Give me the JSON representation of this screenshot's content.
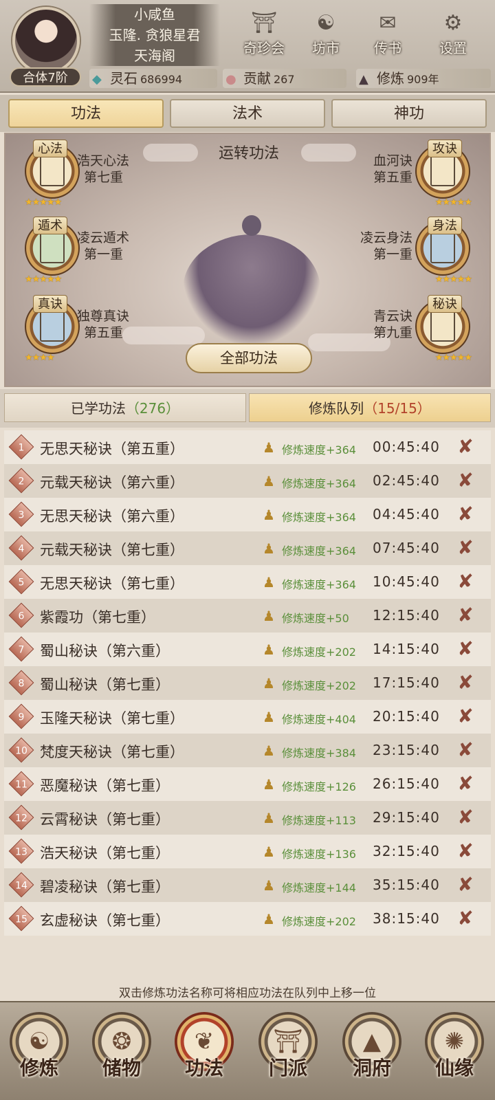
{
  "player": {
    "name": "小咸鱼",
    "title": "玉隆. 贪狼星君",
    "sect": "天海阁",
    "realm": "合体7阶"
  },
  "top_buttons": [
    {
      "label": "奇珍会",
      "icon": "treasure-pavilion-icon"
    },
    {
      "label": "坊市",
      "icon": "market-icon"
    },
    {
      "label": "传书",
      "icon": "scroll-letter-icon"
    },
    {
      "label": "设置",
      "icon": "gear-icon"
    }
  ],
  "resources": [
    {
      "label": "灵石",
      "value": "686994",
      "icon": "spirit-stone-icon"
    },
    {
      "label": "贡献",
      "value": "267",
      "icon": "contribution-icon"
    },
    {
      "label": "修炼",
      "value": "909年",
      "icon": "cultivator-icon"
    }
  ],
  "main_tabs": [
    {
      "label": "功法",
      "active": true
    },
    {
      "label": "法术",
      "active": false
    },
    {
      "label": "神功",
      "active": false
    }
  ],
  "scene": {
    "title": "运转功法",
    "all_button": "全部功法",
    "skills": [
      {
        "type": "心法",
        "name": "浩天心法",
        "level": "第七重",
        "stars": "★★★★★",
        "side": "left"
      },
      {
        "type": "攻诀",
        "name": "血河诀",
        "level": "第五重",
        "stars": "★★★★★",
        "side": "right"
      },
      {
        "type": "遁术",
        "name": "凌云遁术",
        "level": "第一重",
        "stars": "★★★★★",
        "side": "left"
      },
      {
        "type": "身法",
        "name": "凌云身法",
        "level": "第一重",
        "stars": "★★★★★",
        "side": "right"
      },
      {
        "type": "真诀",
        "name": "独尊真诀",
        "level": "第五重",
        "stars": "★★★★",
        "side": "left"
      },
      {
        "type": "秘诀",
        "name": "青云诀",
        "level": "第九重",
        "stars": "★★★★★",
        "side": "right"
      }
    ]
  },
  "sub_tabs": [
    {
      "label": "已学功法",
      "count": "（276）",
      "active": false
    },
    {
      "label": "修炼队列",
      "count": "（15/15）",
      "active": true
    }
  ],
  "queue": [
    {
      "num": "1",
      "name": "无思天秘诀（第五重）",
      "speed": "修炼速度+364",
      "time": "00:45:40"
    },
    {
      "num": "2",
      "name": "元载天秘诀（第六重）",
      "speed": "修炼速度+364",
      "time": "02:45:40"
    },
    {
      "num": "3",
      "name": "无思天秘诀（第六重）",
      "speed": "修炼速度+364",
      "time": "04:45:40"
    },
    {
      "num": "4",
      "name": "元载天秘诀（第七重）",
      "speed": "修炼速度+364",
      "time": "07:45:40"
    },
    {
      "num": "5",
      "name": "无思天秘诀（第七重）",
      "speed": "修炼速度+364",
      "time": "10:45:40"
    },
    {
      "num": "6",
      "name": "紫霞功（第七重）",
      "speed": "修炼速度+50",
      "time": "12:15:40"
    },
    {
      "num": "7",
      "name": "蜀山秘诀（第六重）",
      "speed": "修炼速度+202",
      "time": "14:15:40"
    },
    {
      "num": "8",
      "name": "蜀山秘诀（第七重）",
      "speed": "修炼速度+202",
      "time": "17:15:40"
    },
    {
      "num": "9",
      "name": "玉隆天秘诀（第七重）",
      "speed": "修炼速度+404",
      "time": "20:15:40"
    },
    {
      "num": "10",
      "name": "梵度天秘诀（第七重）",
      "speed": "修炼速度+384",
      "time": "23:15:40"
    },
    {
      "num": "11",
      "name": "恶魔秘诀（第七重）",
      "speed": "修炼速度+126",
      "time": "26:15:40"
    },
    {
      "num": "12",
      "name": "云霄秘诀（第七重）",
      "speed": "修炼速度+113",
      "time": "29:15:40"
    },
    {
      "num": "13",
      "name": "浩天秘诀（第七重）",
      "speed": "修炼速度+136",
      "time": "32:15:40"
    },
    {
      "num": "14",
      "name": "碧凌秘诀（第七重）",
      "speed": "修炼速度+144",
      "time": "35:15:40"
    },
    {
      "num": "15",
      "name": "玄虚秘诀（第七重）",
      "speed": "修炼速度+202",
      "time": "38:15:40"
    }
  ],
  "hint": "双击修炼功法名称可将相应功法在队列中上移一位",
  "bottom_nav": [
    {
      "label": "修炼",
      "icon": "cultivation-icon",
      "active": false
    },
    {
      "label": "储物",
      "icon": "storage-bag-icon",
      "active": false
    },
    {
      "label": "功法",
      "icon": "technique-scroll-icon",
      "active": true
    },
    {
      "label": "门派",
      "icon": "sect-gate-icon",
      "active": false
    },
    {
      "label": "洞府",
      "icon": "cave-dwelling-icon",
      "active": false
    },
    {
      "label": "仙缘",
      "icon": "immortal-fate-icon",
      "active": false
    }
  ]
}
